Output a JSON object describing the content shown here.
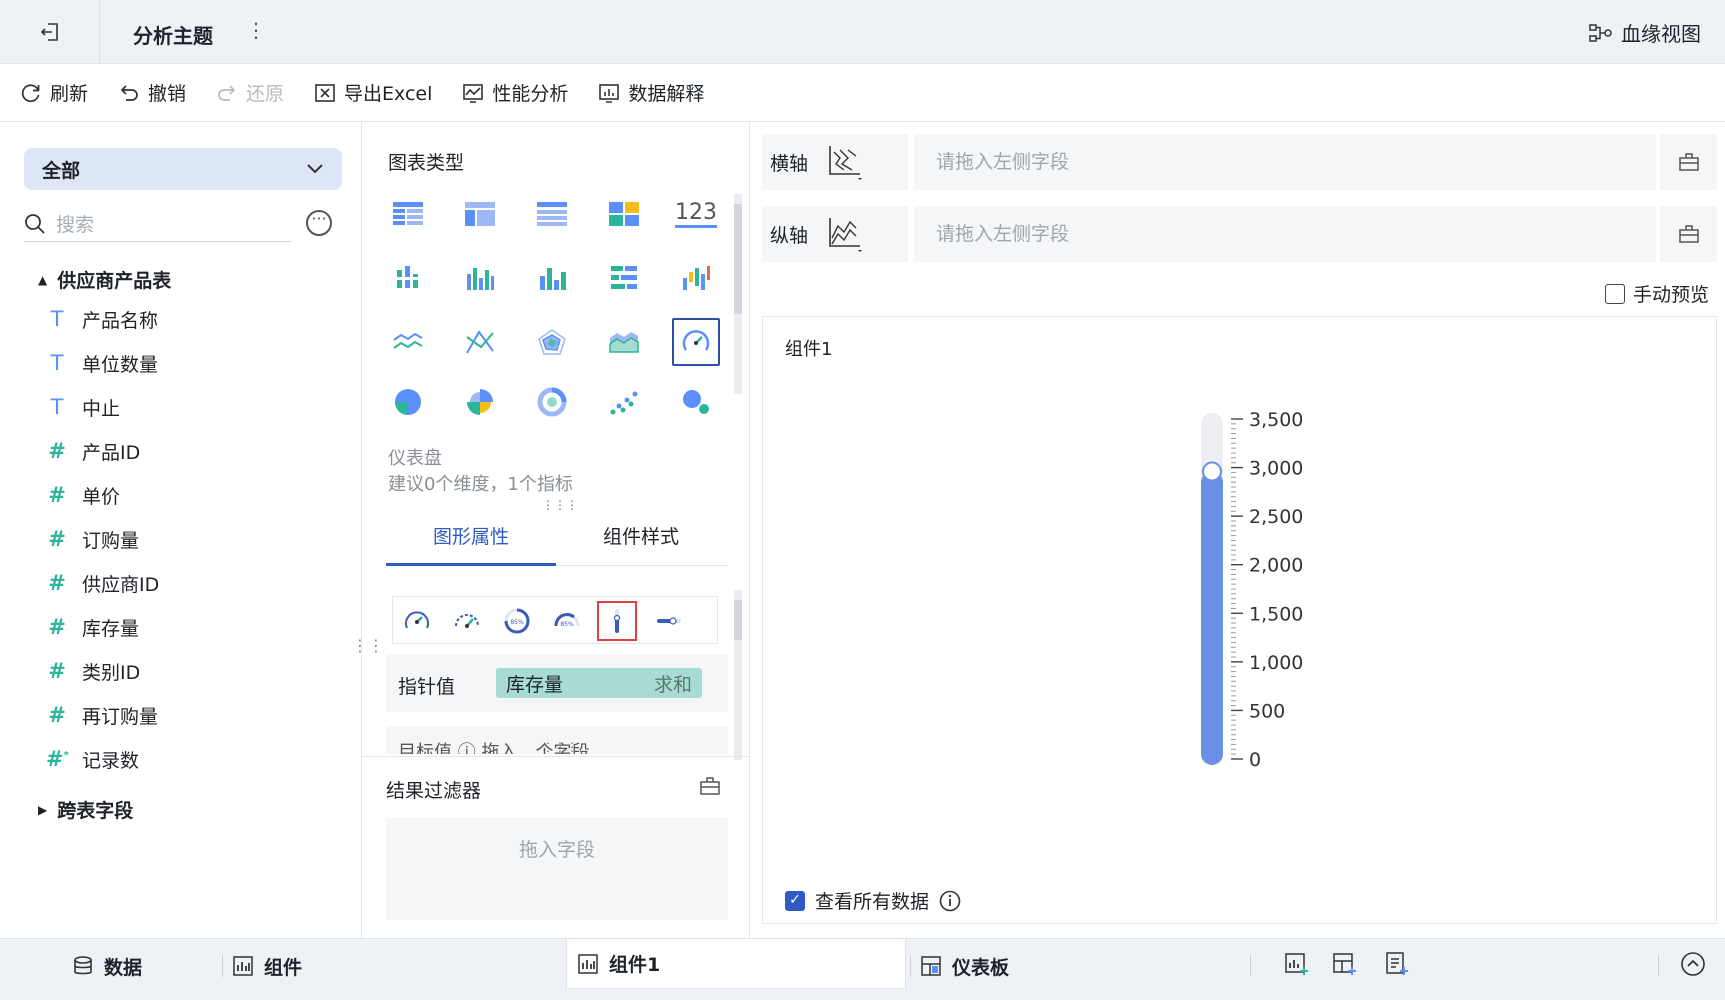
{
  "header": {
    "title": "分析主题",
    "lineage_label": "血缘视图"
  },
  "toolbar": {
    "refresh": "刷新",
    "undo": "撤销",
    "redo": "还原",
    "export_excel": "导出Excel",
    "perf_analysis": "性能分析",
    "data_explain": "数据解释"
  },
  "left": {
    "scope": "全部",
    "search_placeholder": "搜索",
    "group1": "供应商产品表",
    "fields": [
      {
        "type": "text",
        "name": "产品名称"
      },
      {
        "type": "text",
        "name": "单位数量"
      },
      {
        "type": "text",
        "name": "中止"
      },
      {
        "type": "number",
        "name": "产品ID"
      },
      {
        "type": "number",
        "name": "单价"
      },
      {
        "type": "number",
        "name": "订购量"
      },
      {
        "type": "number",
        "name": "供应商ID"
      },
      {
        "type": "number",
        "name": "库存量"
      },
      {
        "type": "number",
        "name": "类别ID"
      },
      {
        "type": "number",
        "name": "再订购量"
      },
      {
        "type": "number-star",
        "name": "记录数"
      }
    ],
    "group2": "跨表字段"
  },
  "middle": {
    "chart_type_title": "图表类型",
    "selected_chart_name": "仪表盘",
    "selected_chart_hint": "建议0个维度，1个指标",
    "tab_graph": "图形属性",
    "tab_style": "组件样式",
    "pointer_label": "指针值",
    "pointer_field": "库存量",
    "pointer_agg": "求和",
    "target_text": "目标值 ⓘ   拖入…个字段",
    "filter_title": "结果过滤器",
    "filter_placeholder": "拖入字段",
    "number_icon_text": "123"
  },
  "right": {
    "x_axis_label": "横轴",
    "y_axis_label": "纵轴",
    "drop_placeholder": "请拖入左侧字段",
    "manual_preview": "手动预览",
    "widget_title": "组件1",
    "view_all": "查看所有数据"
  },
  "chart_data": {
    "type": "gauge",
    "style": "vertical-thermometer",
    "value": 2960,
    "min": 0,
    "max": 3500,
    "ticks": [
      "0",
      "500",
      "1,000",
      "1,500",
      "2,000",
      "2,500",
      "3,000",
      "3,500"
    ],
    "tick_values": [
      0,
      500,
      1000,
      1500,
      2000,
      2500,
      3000,
      3500
    ],
    "color": "#6b8fe6",
    "track_color": "#eceef1"
  },
  "bottom": {
    "data_tab": "数据",
    "widget_tab": "组件",
    "active_tab": "组件1",
    "dashboard_tab": "仪表板"
  },
  "colors": {
    "accent": "#2f5cc4",
    "text_field": "#5b8ff9",
    "number_field": "#2bb59a",
    "selected_red": "#e0413c"
  }
}
